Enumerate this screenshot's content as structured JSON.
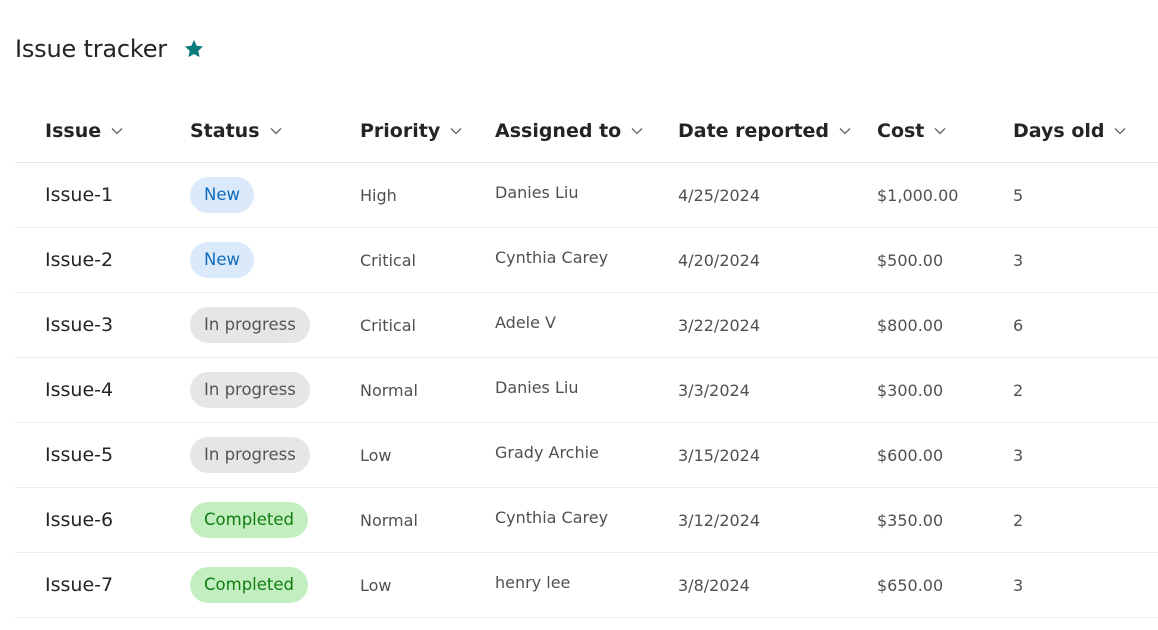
{
  "page": {
    "title": "Issue tracker",
    "favorite_icon": "star-icon",
    "accent_color": "#077a7a"
  },
  "columns": [
    {
      "label": "Issue",
      "icon": "chevron-down-icon"
    },
    {
      "label": "Status",
      "icon": "chevron-down-icon"
    },
    {
      "label": "Priority",
      "icon": "chevron-down-icon"
    },
    {
      "label": "Assigned to",
      "icon": "chevron-down-icon"
    },
    {
      "label": "Date reported",
      "icon": "chevron-down-icon"
    },
    {
      "label": "Cost",
      "icon": "chevron-down-icon"
    },
    {
      "label": "Days old",
      "icon": "chevron-down-icon"
    }
  ],
  "status_colors": {
    "new": {
      "bg": "#dbeafa",
      "fg": "#0f6cbd"
    },
    "in_progress": {
      "bg": "#e6e6e6",
      "fg": "#555555"
    },
    "completed": {
      "bg": "#c3efc0",
      "fg": "#107c10"
    }
  },
  "rows": [
    {
      "issue": "Issue-1",
      "status": "New",
      "status_kind": "new",
      "priority": "High",
      "assigned_to": "Danies Liu",
      "date_reported": "4/25/2024",
      "cost": "$1,000.00",
      "days_old": "5"
    },
    {
      "issue": "Issue-2",
      "status": "New",
      "status_kind": "new",
      "priority": "Critical",
      "assigned_to": "Cynthia Carey",
      "date_reported": "4/20/2024",
      "cost": "$500.00",
      "days_old": "3"
    },
    {
      "issue": "Issue-3",
      "status": "In progress",
      "status_kind": "progress",
      "priority": "Critical",
      "assigned_to": "Adele V",
      "date_reported": "3/22/2024",
      "cost": "$800.00",
      "days_old": "6"
    },
    {
      "issue": "Issue-4",
      "status": "In progress",
      "status_kind": "progress",
      "priority": "Normal",
      "assigned_to": "Danies Liu",
      "date_reported": "3/3/2024",
      "cost": "$300.00",
      "days_old": "2"
    },
    {
      "issue": "Issue-5",
      "status": "In progress",
      "status_kind": "progress",
      "priority": "Low",
      "assigned_to": "Grady Archie",
      "date_reported": "3/15/2024",
      "cost": "$600.00",
      "days_old": "3"
    },
    {
      "issue": "Issue-6",
      "status": "Completed",
      "status_kind": "completed",
      "priority": "Normal",
      "assigned_to": "Cynthia Carey",
      "date_reported": "3/12/2024",
      "cost": "$350.00",
      "days_old": "2"
    },
    {
      "issue": "Issue-7",
      "status": "Completed",
      "status_kind": "completed",
      "priority": "Low",
      "assigned_to": "henry lee",
      "date_reported": "3/8/2024",
      "cost": "$650.00",
      "days_old": "3"
    }
  ]
}
